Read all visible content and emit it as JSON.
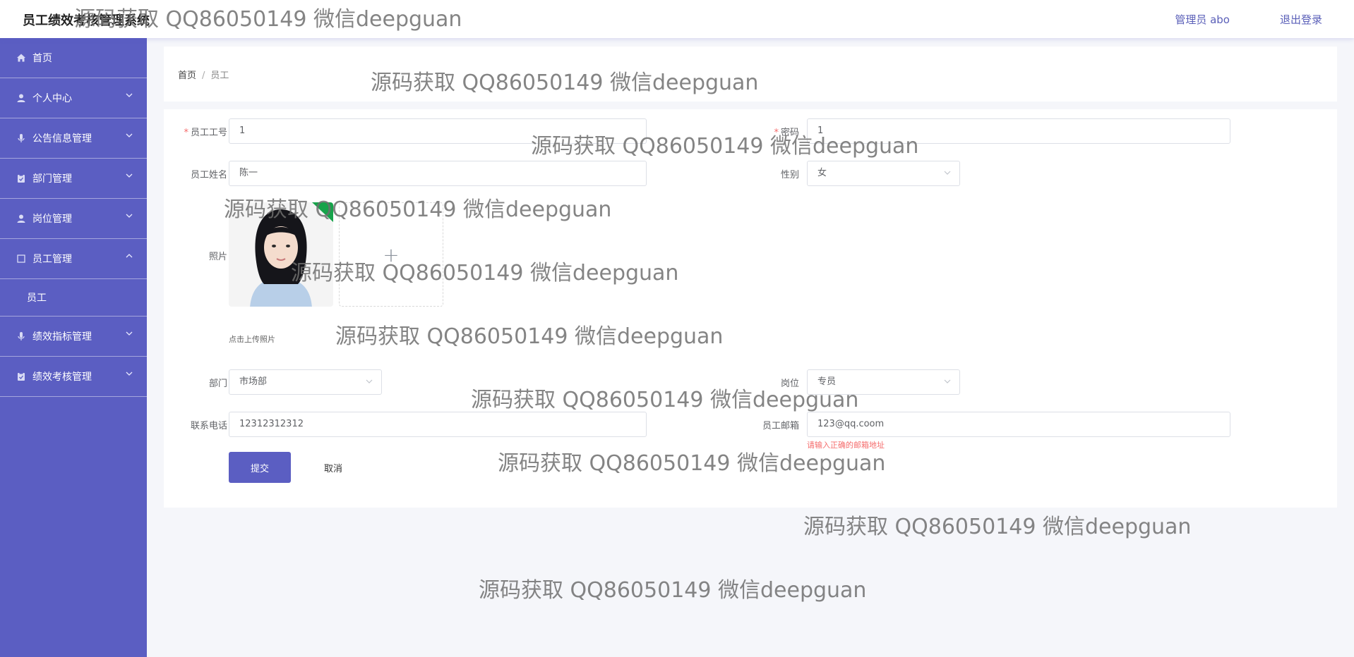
{
  "header": {
    "app_title": "员工绩效考核管理系统",
    "user_label": "管理员 abo",
    "logout_label": "退出登录"
  },
  "sidebar": {
    "items": [
      {
        "label": "首页",
        "icon": "home-icon"
      },
      {
        "label": "个人中心",
        "icon": "user-icon"
      },
      {
        "label": "公告信息管理",
        "icon": "microphone-icon"
      },
      {
        "label": "部门管理",
        "icon": "clipboard-icon"
      },
      {
        "label": "岗位管理",
        "icon": "user-icon"
      },
      {
        "label": "员工管理",
        "icon": "square-icon",
        "expanded": true,
        "children": [
          {
            "label": "员工"
          }
        ]
      },
      {
        "label": "绩效指标管理",
        "icon": "microphone-icon"
      },
      {
        "label": "绩效考核管理",
        "icon": "clipboard-icon"
      }
    ]
  },
  "breadcrumb": {
    "home": "首页",
    "current": "员工"
  },
  "form": {
    "employee_no": {
      "label": "员工工号",
      "value": "1"
    },
    "password": {
      "label": "密码",
      "value": "1"
    },
    "name": {
      "label": "员工姓名",
      "value": "陈一"
    },
    "gender": {
      "label": "性别",
      "value": "女"
    },
    "photo": {
      "label": "照片",
      "hint": "点击上传照片"
    },
    "department": {
      "label": "部门",
      "value": "市场部"
    },
    "position": {
      "label": "岗位",
      "value": "专员"
    },
    "phone": {
      "label": "联系电话",
      "value": "12312312312"
    },
    "email": {
      "label": "员工邮箱",
      "value": "123@qq.coom",
      "error": "请输入正确的邮箱地址"
    },
    "submit_label": "提交",
    "cancel_label": "取消"
  },
  "watermark": "源码获取 QQ86050149 微信deepguan",
  "colors": {
    "primary": "#5b5ec2",
    "error": "#f56c6c"
  }
}
